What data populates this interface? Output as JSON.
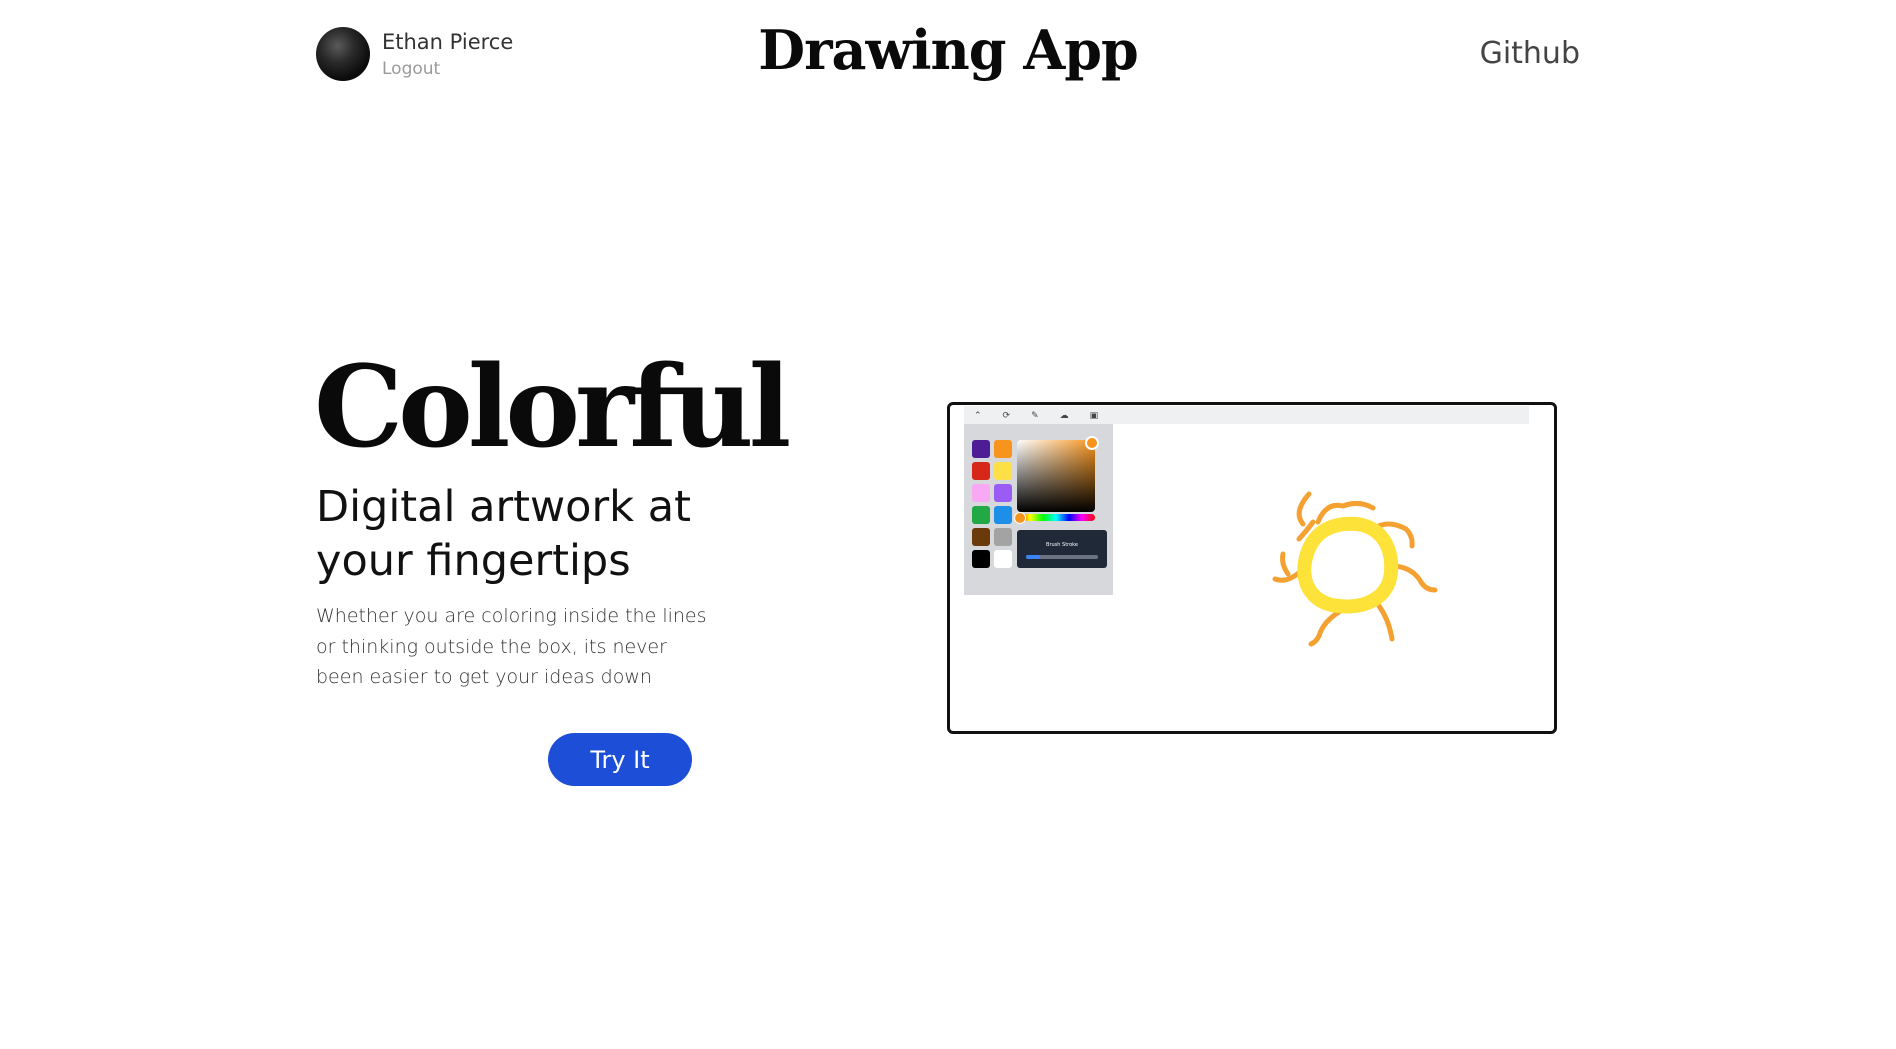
{
  "header": {
    "user_name": "Ethan Pierce",
    "logout_label": "Logout",
    "app_title": "Drawing App",
    "github_label": "Github"
  },
  "hero": {
    "title": "Colorful",
    "subtitle": "Digital artwork at your fingertips",
    "description": "Whether you are coloring inside the lines or thinking outside the box, its never been easier to get your ideas down",
    "cta_label": "Try It"
  },
  "preview": {
    "toolbar_icons": [
      "chevron-up-icon",
      "refresh-icon",
      "pencil-icon",
      "cloud-icon",
      "save-icon"
    ],
    "swatches": [
      "#4c1d95",
      "#f7941d",
      "#d62718",
      "#fde047",
      "#f9a8f4",
      "#9b5cf6",
      "#22a845",
      "#1e8fe8",
      "#6b3a0a",
      "#a3a3a3",
      "#000000",
      "#ffffff"
    ],
    "selected_color": "#f7941d",
    "brush_label": "Brush Stroke",
    "brush_size": 0.2,
    "sun_core_color": "#fde23a",
    "sun_ray_color": "#f4a131"
  },
  "colors": {
    "cta_background": "#1d4ed8",
    "title_color": "#0a0a0a"
  }
}
